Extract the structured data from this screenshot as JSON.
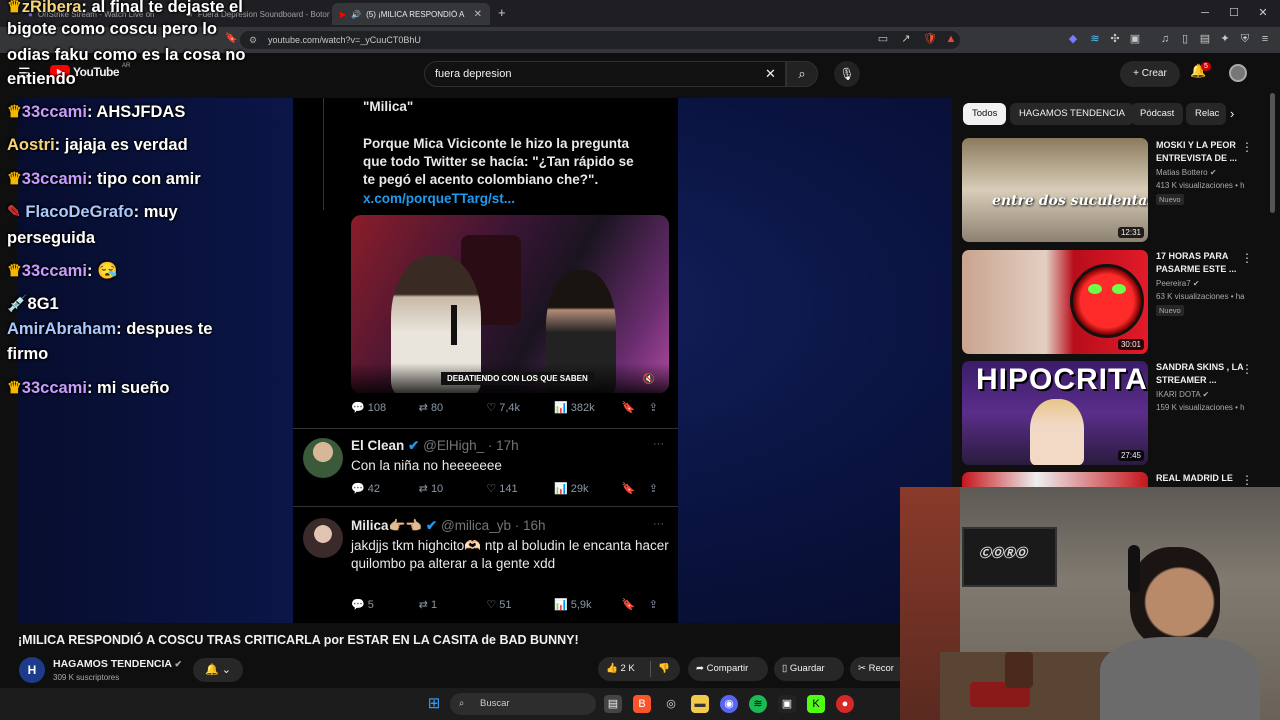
{
  "browser": {
    "tabs": [
      {
        "title": "OnStrike Stream - Watch Live on"
      },
      {
        "title": "Fuera Depresion Soundboard - Boton"
      },
      {
        "title": "(5) ¡MILICA RESPONDIÓ A COSCU"
      }
    ],
    "url": "youtube.com/watch?v=_yCuuCT0BhU"
  },
  "youtube": {
    "logo": "YouTube",
    "region": "AR",
    "search_value": "fuera depresion",
    "create_label": "Crear",
    "notif_count": "5"
  },
  "chat": [
    {
      "user": "zRibera",
      "msg": "al final te dejaste el",
      "cont": "bigote como coscu pero lo",
      "cont2": "odias faku como es la cosa no",
      "cont3": "entiendo"
    },
    {
      "user": "33ccami",
      "msg": "AHSJFDAS"
    },
    {
      "user": "Aostri",
      "msg": "jajaja es verdad"
    },
    {
      "user": "33ccami",
      "msg": "tipo con amir"
    },
    {
      "user": "FlacoDeGrafo",
      "msg": "muy",
      "cont": "perseguida"
    },
    {
      "user": "33ccami",
      "msg": "😪"
    },
    {
      "user": "",
      "msg": "💉8G1"
    },
    {
      "user": "AmirAbraham",
      "msg": "despues te",
      "cont": "firmo"
    },
    {
      "user": "33ccami",
      "msg": "mi sueño"
    }
  ],
  "tweet": {
    "quote_title": "\"Milica\"",
    "body_1": "Porque Mica Viciconte le hizo la pregunta",
    "body_2": "que todo Twitter se hacía: \"¿Tan rápido se",
    "body_3": "te pegó el acento colombiano che?\".",
    "link": "x.com/porqueTTarg/st...",
    "image_caption": "DEBATIENDO CON LOS QUE SABEN",
    "metrics": [
      "108",
      "80",
      "7,4k",
      "382k"
    ]
  },
  "replies": [
    {
      "name": "El Clean",
      "handle": "@ElHigh_ · 17h",
      "body": "Con la niña no heeeeeee",
      "metrics": [
        "42",
        "10",
        "141",
        "29k"
      ]
    },
    {
      "name": "Milica👉🏼👈🏼",
      "handle": "@milica_yb · 16h",
      "body": "jakdjjs tkm highcito🫶🏻 ntp al boludin le encanta hacer quilombo pa alterar a la gente xdd",
      "metrics": [
        "5",
        "1",
        "51",
        "5,9k"
      ]
    }
  ],
  "video": {
    "title": "¡MILICA RESPONDIÓ A COSCU TRAS CRITICARLA por ESTAR EN LA CASITA de BAD BUNNY!",
    "channel": "HAGAMOS TENDENCIA",
    "subscribers": "309 K suscriptores",
    "likes": "2 K",
    "share_label": "Compartir",
    "save_label": "Guardar",
    "clip_label": "Recor"
  },
  "sidebar": {
    "chips": [
      "Todos",
      "HAGAMOS TENDENCIA",
      "Pódcast",
      "Relac"
    ],
    "cards": [
      {
        "title": "MOSKI Y LA PEOR ENTREVISTA DE ...",
        "channel": "Matias Bottero",
        "views": "413 K visualizaciones • h",
        "badge": "Nuevo",
        "duration": "12:31",
        "thumb_text": "entre dos suculentas MOSKI"
      },
      {
        "title": "17 HORAS PARA PASARME ESTE ...",
        "channel": "Peereira7",
        "views": "63 K visualizaciones • ha",
        "badge": "Nuevo",
        "duration": "30:01",
        "thumb_text": ""
      },
      {
        "title": "SANDRA SKINS , LA STREAMER ...",
        "channel": "IKARI DOTA",
        "views": "159 K visualizaciones • h",
        "badge": "",
        "duration": "27:45",
        "thumb_text": "HIPOCRITA"
      },
      {
        "title": "REAL MADRID LE",
        "channel": "",
        "views": "",
        "badge": "",
        "duration": "",
        "thumb_text": ""
      }
    ]
  },
  "taskbar": {
    "search_placeholder": "Buscar"
  },
  "colors": {
    "youtube_red": "#ff0000",
    "twitter_blue": "#1d9bf0",
    "chat_crown": "#f5b800"
  }
}
